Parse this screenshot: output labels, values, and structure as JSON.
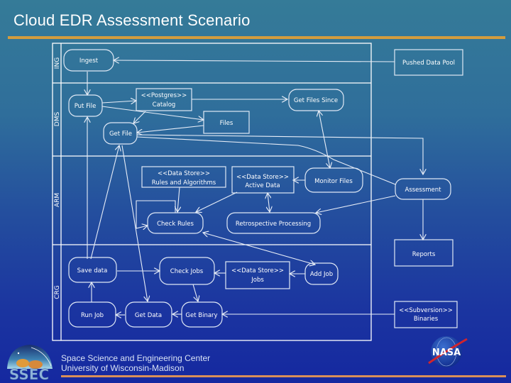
{
  "slide": {
    "title": "Cloud EDR Assessment Scenario",
    "footer": {
      "line1": "Space Science and Engineering Center",
      "line2": "University of Wisconsin-Madison",
      "ssec_logo_text": "SSEC",
      "nasa_logo_text": "NASA"
    },
    "colors": {
      "accent_rule_top": "#d39c3e",
      "accent_rule_bottom": "#d98f58",
      "background_top": "#357b98",
      "background_bottom": "#1528a0"
    }
  },
  "diagram": {
    "lanes": [
      {
        "id": "ING",
        "label": "ING"
      },
      {
        "id": "DMS",
        "label": "DMS"
      },
      {
        "id": "ARM",
        "label": "ARM"
      },
      {
        "id": "CRG",
        "label": "CRG"
      }
    ],
    "nodes": {
      "ingest": {
        "label": "Ingest",
        "kind": "activity",
        "lane": "ING"
      },
      "pushed_data_pool": {
        "label": "Pushed Data Pool",
        "kind": "object",
        "lane": "external"
      },
      "put_file": {
        "label": "Put File",
        "kind": "activity",
        "lane": "DMS"
      },
      "postgres_catalog": {
        "stereotype": "<<Postgres>>",
        "label": "Catalog",
        "kind": "object",
        "lane": "DMS"
      },
      "get_files_since": {
        "label": "Get Files Since",
        "kind": "activity",
        "lane": "DMS"
      },
      "files": {
        "label": "Files",
        "kind": "object",
        "lane": "DMS"
      },
      "get_file": {
        "label": "Get File",
        "kind": "activity",
        "lane": "DMS"
      },
      "rules_algorithms": {
        "stereotype": "<<Data Store>>",
        "label": "Rules and Algorithms",
        "kind": "object",
        "lane": "ARM"
      },
      "active_data": {
        "stereotype": "<<Data Store>>",
        "label": "Active Data",
        "kind": "object",
        "lane": "ARM"
      },
      "monitor_files": {
        "label": "Monitor Files",
        "kind": "activity",
        "lane": "ARM"
      },
      "assessment": {
        "label": "Assessment",
        "kind": "activity",
        "lane": "external"
      },
      "check_rules": {
        "label": "Check Rules",
        "kind": "activity",
        "lane": "ARM"
      },
      "retrospective_processing": {
        "label": "Retrospective Processing",
        "kind": "activity",
        "lane": "ARM"
      },
      "reports": {
        "label": "Reports",
        "kind": "object",
        "lane": "external"
      },
      "save_data": {
        "label": "Save data",
        "kind": "activity",
        "lane": "CRG"
      },
      "check_jobs": {
        "label": "Check Jobs",
        "kind": "activity",
        "lane": "CRG"
      },
      "jobs": {
        "stereotype": "<<Data Store>>",
        "label": "Jobs",
        "kind": "object",
        "lane": "CRG"
      },
      "add_job": {
        "label": "Add Job",
        "kind": "activity",
        "lane": "CRG"
      },
      "run_job": {
        "label": "Run Job",
        "kind": "activity",
        "lane": "CRG"
      },
      "get_data": {
        "label": "Get Data",
        "kind": "activity",
        "lane": "CRG"
      },
      "get_binary": {
        "label": "Get Binary",
        "kind": "activity",
        "lane": "CRG"
      },
      "subversion_binaries": {
        "stereotype": "<<Subversion>>",
        "label": "Binaries",
        "kind": "object",
        "lane": "external"
      }
    },
    "edges": [
      {
        "from": "pushed_data_pool",
        "to": "ingest"
      },
      {
        "from": "ingest",
        "to": "put_file"
      },
      {
        "from": "put_file",
        "to": "postgres_catalog"
      },
      {
        "from": "put_file",
        "to": "files"
      },
      {
        "from": "postgres_catalog",
        "to": "get_files_since"
      },
      {
        "from": "postgres_catalog",
        "to": "get_file"
      },
      {
        "from": "files",
        "to": "get_file"
      },
      {
        "from": "get_files_since",
        "to": "monitor_files",
        "bidirectional": true
      },
      {
        "from": "get_file",
        "to": "assessment"
      },
      {
        "from": "assessment",
        "to": "get_file"
      },
      {
        "from": "monitor_files",
        "to": "active_data"
      },
      {
        "from": "rules_algorithms",
        "to": "check_rules"
      },
      {
        "from": "active_data",
        "to": "check_rules"
      },
      {
        "from": "active_data",
        "to": "retrospective_processing",
        "bidirectional": true
      },
      {
        "from": "check_rules",
        "to": "check_rules",
        "self_loop": true
      },
      {
        "from": "assessment",
        "to": "retrospective_processing"
      },
      {
        "from": "monitor_files",
        "to": "assessment"
      },
      {
        "from": "assessment",
        "to": "reports"
      },
      {
        "from": "add_job",
        "to": "check_rules"
      },
      {
        "from": "check_rules",
        "to": "add_job"
      },
      {
        "from": "save_data",
        "to": "check_jobs"
      },
      {
        "from": "jobs",
        "to": "check_jobs"
      },
      {
        "from": "add_job",
        "to": "jobs"
      },
      {
        "from": "check_jobs",
        "to": "get_binary"
      },
      {
        "from": "get_binary",
        "to": "get_data"
      },
      {
        "from": "get_data",
        "to": "run_job"
      },
      {
        "from": "run_job",
        "to": "save_data"
      },
      {
        "from": "subversion_binaries",
        "to": "get_binary"
      },
      {
        "from": "get_file",
        "to": "get_data"
      },
      {
        "from": "save_data",
        "to": "put_file"
      },
      {
        "from": "get_file",
        "to": "save_data"
      }
    ]
  }
}
